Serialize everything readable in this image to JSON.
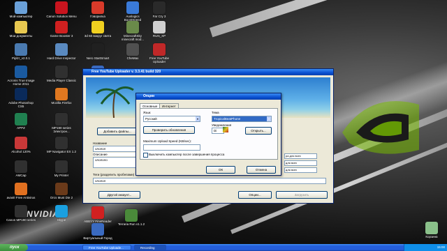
{
  "desktop_icons": [
    {
      "label": "Мой компьютер",
      "color": "#6aa0d8"
    },
    {
      "label": "Canon Solution Menu",
      "color": "#c8141e"
    },
    {
      "label": "Говорилка",
      "color": "#d83a2a"
    },
    {
      "label": "Auslogics BoostSpeed",
      "color": "#3a7ad8"
    },
    {
      "label": "Far Cry 3",
      "color": "#2a2a2a"
    },
    {
      "label": "Мои документы",
      "color": "#e8c850"
    },
    {
      "label": "Game Booster 3",
      "color": "#d02020"
    },
    {
      "label": "3d 60 вокруг света",
      "color": "#f0d020"
    },
    {
      "label": "MinecraftSky minecraft mod...",
      "color": "#6a8a4a"
    },
    {
      "label": "RUN_XP",
      "color": "#d0d0d0"
    },
    {
      "label": "Piplzr_v2.0.1",
      "color": "#4a7ab0"
    },
    {
      "label": "Hard Drive Inspector",
      "color": "#5a8ac0"
    },
    {
      "label": "Nero StartSmart",
      "color": "#202020"
    },
    {
      "label": "CheMax",
      "color": "#505050"
    },
    {
      "label": "Free YouTube Uploader",
      "color": "#c02828"
    },
    {
      "label": "Acronis True Image Home 2011",
      "color": "#1a5aa0"
    },
    {
      "label": "Media Player Classic",
      "color": "#303030"
    },
    {
      "label": "Проигрыв. обво...",
      "color": "#3a6ac0"
    },
    {
      "label": "Adobe Photoshop CS5",
      "color": "#0a2a5a"
    },
    {
      "label": "Mozilla Firefox",
      "color": "#e07820"
    },
    {
      "label": "Оп",
      "color": "#3a6ac0"
    },
    {
      "label": "APPZ",
      "color": "#208050"
    },
    {
      "label": "MP190 series Электрон...",
      "color": "#303030"
    },
    {
      "label": "Alcohol 120%",
      "color": "#c83838"
    },
    {
      "label": "MP Navigator EX 1.2",
      "color": "#303030"
    },
    {
      "label": "AMCap",
      "color": "#303030"
    },
    {
      "label": "My Printer",
      "color": "#303030"
    },
    {
      "label": "avast! Free Antivirus",
      "color": "#e07020"
    },
    {
      "label": "Orcs Must Die 2",
      "color": "#6a3a1a"
    },
    {
      "label": "Canon MP190 series",
      "color": "#303030"
    },
    {
      "label": "Skype",
      "color": "#1aa0e0"
    },
    {
      "label": "ABBYY FineReader 10",
      "color": "#d02020"
    },
    {
      "label": "Terraria Run v1.1.2",
      "color": "#4a8a3a"
    },
    {
      "label": "Виртуальный Город",
      "color": "#3a6ac0"
    },
    {
      "label": "Корзина",
      "color": "#8ac08a"
    }
  ],
  "nvidia_text": "NVIDIA",
  "main_window": {
    "title": "Free YouTube Uploader  v. 3.3.41 build 320",
    "add_files_button": "Добавить файлы...",
    "name_label": "Название",
    "name_value": "ололол",
    "description_label": "Описание",
    "description_value": "олололо",
    "tags_label": "Теги (разделить пробелами)",
    "tags_value": "ололол",
    "other_account_button": "Другой аккаунт...",
    "options_button": "Опции...",
    "upload_button": "Загрузить",
    "categories": [
      "ра для всех",
      "для всех",
      "для всех"
    ]
  },
  "options_dialog": {
    "title": "Опции",
    "tabs": [
      "Основные",
      "Интернет"
    ],
    "language_label": "Язык",
    "language_value": "Русский",
    "theme_label": "Тема",
    "theme_value": "TropicalBeatPhone",
    "check_updates_button": "Проверить обновления",
    "open_button": "Открыть...",
    "notify_label": "Уведомления",
    "notify_value": "Di",
    "upload_speed_label": "Maximum Upload Speed (KB/sec):",
    "shutdown_label": "Выключить компьютер после завершения процесса",
    "ok_button": "ОК",
    "cancel_button": "Отмена"
  },
  "taskbar": {
    "start_label": "пуск",
    "tasks": [
      "Free YouTube Uploade...",
      "Recording"
    ],
    "time": "15:00"
  }
}
